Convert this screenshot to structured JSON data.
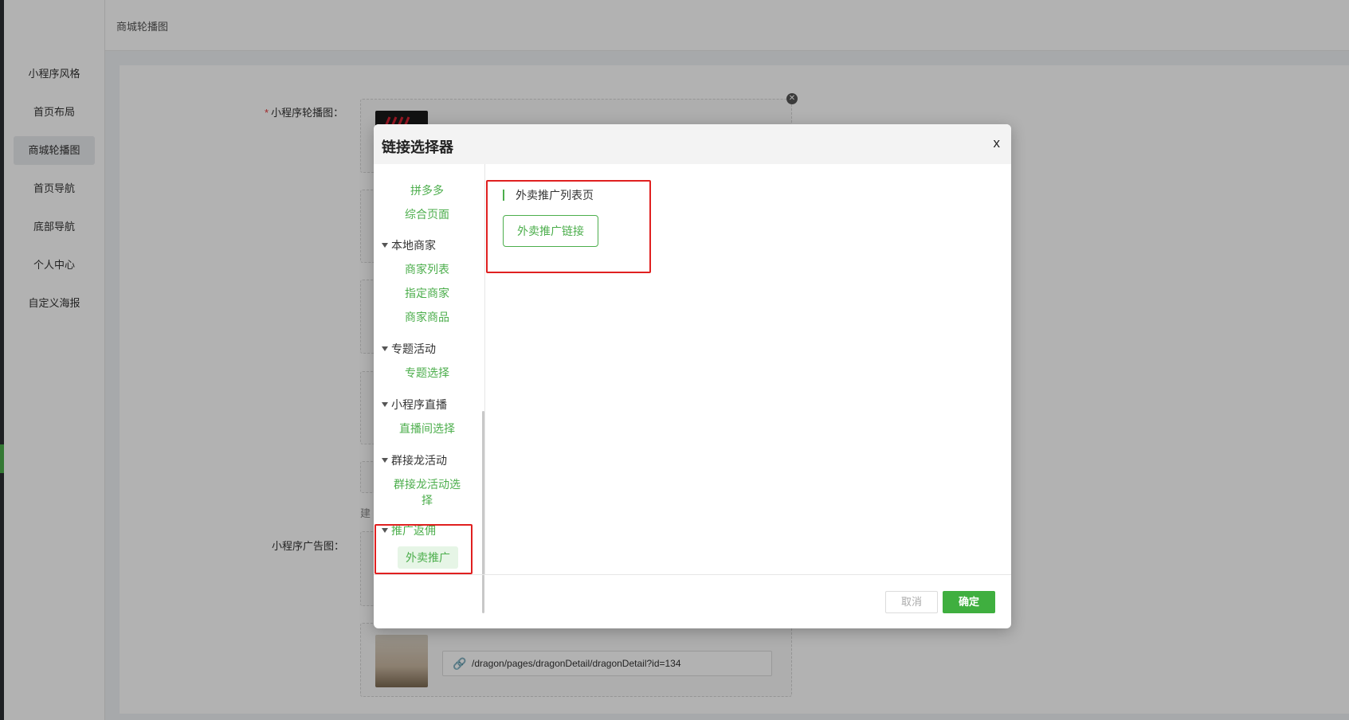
{
  "page": {
    "breadcrumb": "商城轮播图",
    "sidebar": [
      {
        "label": "小程序风格"
      },
      {
        "label": "首页布局"
      },
      {
        "label": "商城轮播图"
      },
      {
        "label": "首页导航"
      },
      {
        "label": "底部导航"
      },
      {
        "label": "个人中心"
      },
      {
        "label": "自定义海报"
      }
    ],
    "form": {
      "carousel_label": "小程序轮播图：",
      "ad_label": "小程序广告图：",
      "tip_fragment": "建",
      "link_value": "/dragon/pages/dragonDetail/dragonDetail?id=134"
    }
  },
  "dialog": {
    "title": "链接选择器",
    "close": "x",
    "nav": {
      "top_links": [
        "拼多多",
        "综合页面"
      ],
      "groups": [
        {
          "title": "本地商家",
          "items": [
            "商家列表",
            "指定商家",
            "商家商品"
          ]
        },
        {
          "title": "专题活动",
          "items": [
            "专题选择"
          ]
        },
        {
          "title": "小程序直播",
          "items": [
            "直播间选择"
          ]
        },
        {
          "title": "群接龙活动",
          "items": [
            "群接龙活动选",
            "择"
          ]
        },
        {
          "title": "推广返佣",
          "items": [
            "外卖推广"
          ]
        }
      ]
    },
    "section_title": "外卖推广列表页",
    "option_button": "外卖推广链接",
    "cancel": "取消",
    "confirm": "确定"
  }
}
